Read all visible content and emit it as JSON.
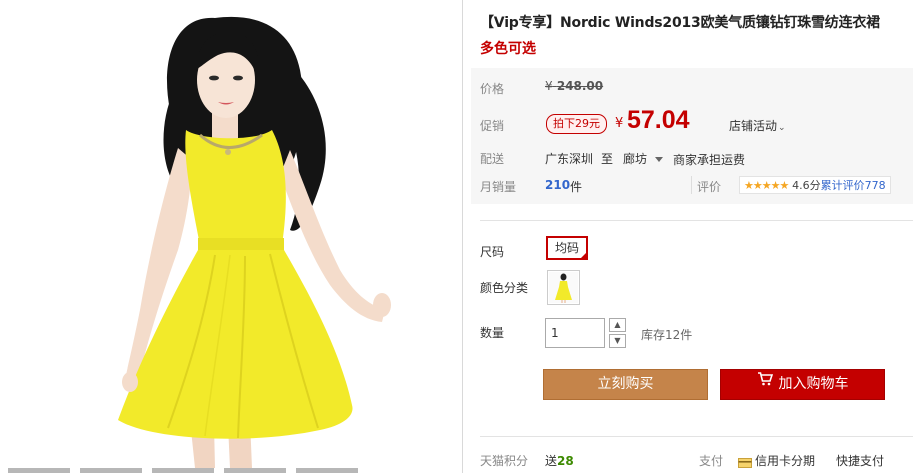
{
  "product": {
    "title": "【Vip专享】Nordic Winds2013欧美气质镶钻钉珠雪纺连衣裙",
    "subtitle": "多色可选"
  },
  "price": {
    "label": "价格",
    "currency": "¥",
    "original": "248.00"
  },
  "promo": {
    "label": "促销",
    "tag": "拍下29元",
    "currency": "¥",
    "price": "57.04",
    "shop_activity": "店铺活动"
  },
  "shipping": {
    "label": "配送",
    "from": "广东深圳",
    "to_word": "至",
    "destination": "廊坊",
    "fee": "商家承担运费"
  },
  "sales": {
    "label": "月销量",
    "count": "210",
    "unit": "件",
    "rating_label": "评价",
    "stars": "★★★★★",
    "score": "4.6分",
    "cumulative": "累计评价778"
  },
  "options": {
    "size_label": "尺码",
    "size_value": "均码",
    "color_label": "颜色分类",
    "quantity_label": "数量",
    "quantity_value": "1",
    "stock": "库存12件"
  },
  "actions": {
    "buy_now": "立刻购买",
    "add_to_cart": "加入购物车"
  },
  "footer": {
    "points_label": "天猫积分",
    "points_prefix": "送",
    "points_value": "28",
    "pay_label": "支付",
    "pay_credit": "信用卡分期",
    "pay_quick": "快捷支付"
  },
  "colors": {
    "accent_red": "#c40000",
    "buy_button": "#c5844a",
    "dress_yellow": "#f2ea2a",
    "link_blue": "#3366cc"
  }
}
